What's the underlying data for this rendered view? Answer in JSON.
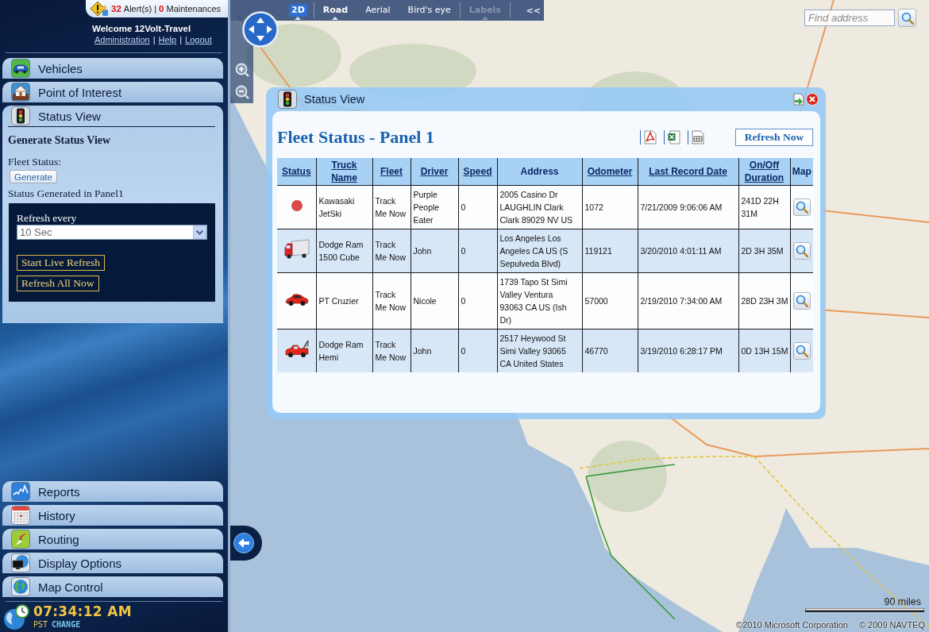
{
  "alerts": {
    "alert_count": "32",
    "alert_label": "Alert(s)",
    "separator": "|",
    "maintenance_count": "0",
    "maintenance_label": "Maintenances"
  },
  "account": {
    "welcome": "Welcome 12Volt-Travel",
    "links": [
      "Administration",
      "Help",
      "Logout"
    ],
    "separator": "|"
  },
  "menu": [
    {
      "label": "Vehicles",
      "expanded": false
    },
    {
      "label": "Point of Interest",
      "expanded": false
    },
    {
      "label": "Status View",
      "expanded": true
    },
    {
      "label": "Reports",
      "expanded": false
    },
    {
      "label": "History",
      "expanded": false
    },
    {
      "label": "Routing",
      "expanded": false
    },
    {
      "label": "Display Options",
      "expanded": false
    },
    {
      "label": "Map Control",
      "expanded": false
    }
  ],
  "status_form": {
    "heading": "Generate Status View",
    "fleet_label": "Fleet Status:",
    "generate_button": "Generate",
    "message": "Status Generated in Panel1",
    "refresh_label": "Refresh every",
    "refresh_interval": {
      "value": "10 Sec"
    },
    "buttons": [
      "Start Live Refresh",
      "Refresh All Now"
    ]
  },
  "clock": {
    "time": "07:34:12 AM",
    "zone": "PST",
    "change_link": "CHANGE"
  },
  "map_toolbar": {
    "items": [
      {
        "kind": "mode",
        "label": "2D",
        "selected": true,
        "dropdown": true,
        "disabled": false
      },
      {
        "kind": "view",
        "label": "Road",
        "selected": true,
        "dropdown": true,
        "disabled": false
      },
      {
        "kind": "view",
        "label": "Aerial",
        "selected": false,
        "dropdown": false,
        "disabled": false
      },
      {
        "kind": "view",
        "label": "Bird's eye",
        "selected": false,
        "dropdown": false,
        "disabled": false
      },
      {
        "kind": "toggle",
        "label": "Labels",
        "selected": false,
        "dropdown": true,
        "disabled": true
      }
    ],
    "collapse_button": "<<"
  },
  "find_address": {
    "placeholder": "Find address"
  },
  "map": {
    "scale": "90 miles",
    "copyright": [
      "©2010 Microsoft Corporation",
      "© 2009 NAVTEQ"
    ]
  },
  "status_window": {
    "title": "Status View",
    "heading": "Fleet Status - Panel 1",
    "refresh_button": "Refresh Now",
    "columns": [
      {
        "label": "Status",
        "sortable": true
      },
      {
        "label": "Truck Name",
        "sortable": true
      },
      {
        "label": "Fleet",
        "sortable": true
      },
      {
        "label": "Driver",
        "sortable": true
      },
      {
        "label": "Speed",
        "sortable": true
      },
      {
        "label": "Address",
        "sortable": false
      },
      {
        "label": "Odometer",
        "sortable": true
      },
      {
        "label": "Last Record Date",
        "sortable": true
      },
      {
        "label": "On/Off Duration",
        "sortable": true
      },
      {
        "label": "Map",
        "sortable": false
      }
    ],
    "rows": [
      {
        "kind": "dot",
        "cells": [
          "",
          "Kawasaki JetSki",
          "Track Me Now",
          "Purple People Eater",
          "0",
          "2005 Casino Dr LAUGHLIN Clark Clark 89029 NV US",
          "1072",
          "7/21/2009 9:06:06 AM",
          "241D 22H 31M"
        ]
      },
      {
        "kind": "truck",
        "cells": [
          "",
          "Dodge Ram 1500 Cube",
          "Track Me Now",
          "John",
          "0",
          "Los Angeles Los Angeles CA US (S Sepulveda Blvd)",
          "119121",
          "3/20/2010 4:01:11 AM",
          "2D 3H 35M"
        ]
      },
      {
        "kind": "car",
        "cells": [
          "",
          "PT Cruzier",
          "Track Me Now",
          "Nicole",
          "0",
          "1739 Tapo St Simi Valley Ventura 93063 CA US (Ish Dr)",
          "57000",
          "2/19/2010 7:34:00 AM",
          "28D 23H 3M"
        ]
      },
      {
        "kind": "towtruck",
        "cells": [
          "",
          "Dodge Ram Hemi",
          "Track Me Now",
          "John",
          "0",
          "2517 Heywood St Simi Valley 93065 CA United States",
          "46770",
          "3/19/2010 6:28:17 PM",
          "0D 13H 15M"
        ]
      }
    ]
  }
}
